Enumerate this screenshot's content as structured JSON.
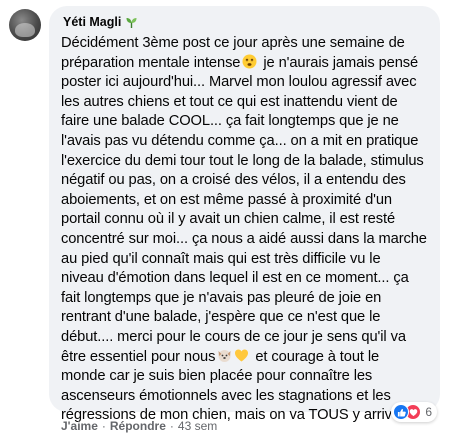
{
  "comment": {
    "author": "Yéti Magli",
    "badge_icon": "plant-badge-icon",
    "lines": [
      "Décidément 3ème post ce jour après une semaine de",
      "préparation mentale intense",
      " je n'aurais jamais pensé",
      "poster ici aujourd'hui... Marvel mon loulou agressif avec",
      "les autres chiens et tout ce qui est inattendu vient de",
      "faire une balade COOL... ça fait longtemps que je ne",
      "l'avais pas vu détendu comme ça... on a mit en pratique",
      "l'exercice du demi tour tout le long de la balade, stimulus",
      "négatif ou pas, on a croisé des vélos, il a entendu des",
      "aboiements, et on est même passé à proximité d'un",
      "portail connu où il y avait un chien calme, il est resté",
      "concentré sur moi... ça nous a aidé aussi dans la marche",
      "au pied qu'il connaît mais qui est très difficile vu le",
      "niveau d'émotion dans lequel il est en ce moment... ça",
      "fait longtemps que je n'avais pas pleuré de joie en",
      "rentrant d'une balade, j'espère que ce n'est que le",
      "début.... merci pour le cours de ce jour je sens qu'il va",
      "être essentiel pour nous",
      " et courage à tout le",
      "monde car je suis bien placée pour connaître les",
      "ascenseurs émotionnels avec les stagnations et les",
      "régressions de mon chien, mais on va TOUS y arriver!!!!"
    ],
    "emojis": {
      "face": "dizzy-face-emoji",
      "dog": "dog-face-emoji",
      "heart": "yellow-heart-emoji"
    },
    "reactions": {
      "types": [
        "like-icon",
        "love-icon"
      ],
      "count": "6"
    },
    "actions": {
      "like": "J'aime",
      "reply": "Répondre",
      "time": "43 sem"
    }
  }
}
